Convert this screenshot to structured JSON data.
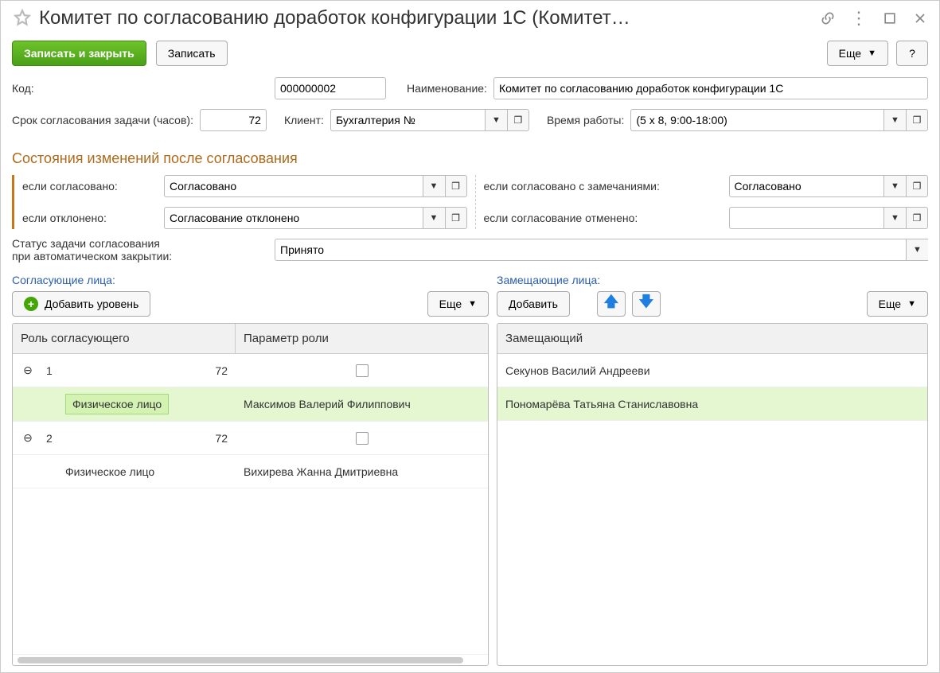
{
  "title": "Комитет по согласованию доработок конфигурации 1С (Комитет…",
  "buttons": {
    "save_close": "Записать и закрыть",
    "save": "Записать",
    "more": "Еще",
    "help": "?"
  },
  "fields": {
    "code_label": "Код:",
    "code_value": "000000002",
    "name_label": "Наименование:",
    "name_value": "Комитет по согласованию доработок конфигурации 1С",
    "deadline_label": "Срок согласования задачи (часов):",
    "deadline_value": "72",
    "client_label": "Клиент:",
    "client_value": "Бухгалтерия №",
    "worktime_label": "Время работы:",
    "worktime_value": "(5 x 8, 9:00-18:00)"
  },
  "section_heading": "Состояния изменений после согласования",
  "states": {
    "approved_label": "если согласовано:",
    "approved_value": "Согласовано",
    "approved_notes_label": "если согласовано с замечаниями:",
    "approved_notes_value": "Согласовано",
    "rejected_label": "если отклонено:",
    "rejected_value": "Согласование отклонено",
    "cancelled_label": "если согласование отменено:",
    "cancelled_value": ""
  },
  "autoclose": {
    "label": "Статус задачи согласования\nпри автоматическом закрытии:",
    "value": "Принято"
  },
  "approvers": {
    "heading": "Согласующие лица:",
    "add_level": "Добавить уровень",
    "more": "Еще",
    "col_role": "Роль согласующего",
    "col_param": "Параметр роли",
    "rows": [
      {
        "level": "1",
        "hours": "72"
      },
      {
        "role": "Физическое лицо",
        "param": "Максимов Валерий Филиппович",
        "selected": true
      },
      {
        "level": "2",
        "hours": "72"
      },
      {
        "role": "Физическое лицо",
        "param": "Вихирева Жанна Дмитриевна"
      }
    ]
  },
  "substitutes": {
    "heading": "Замещающие лица:",
    "add": "Добавить",
    "more": "Еще",
    "col": "Замещающий",
    "rows": [
      {
        "name": "Секунов Василий Андрееви"
      },
      {
        "name": "Пономарёва Татьяна Станиславовна",
        "selected": true
      }
    ]
  }
}
